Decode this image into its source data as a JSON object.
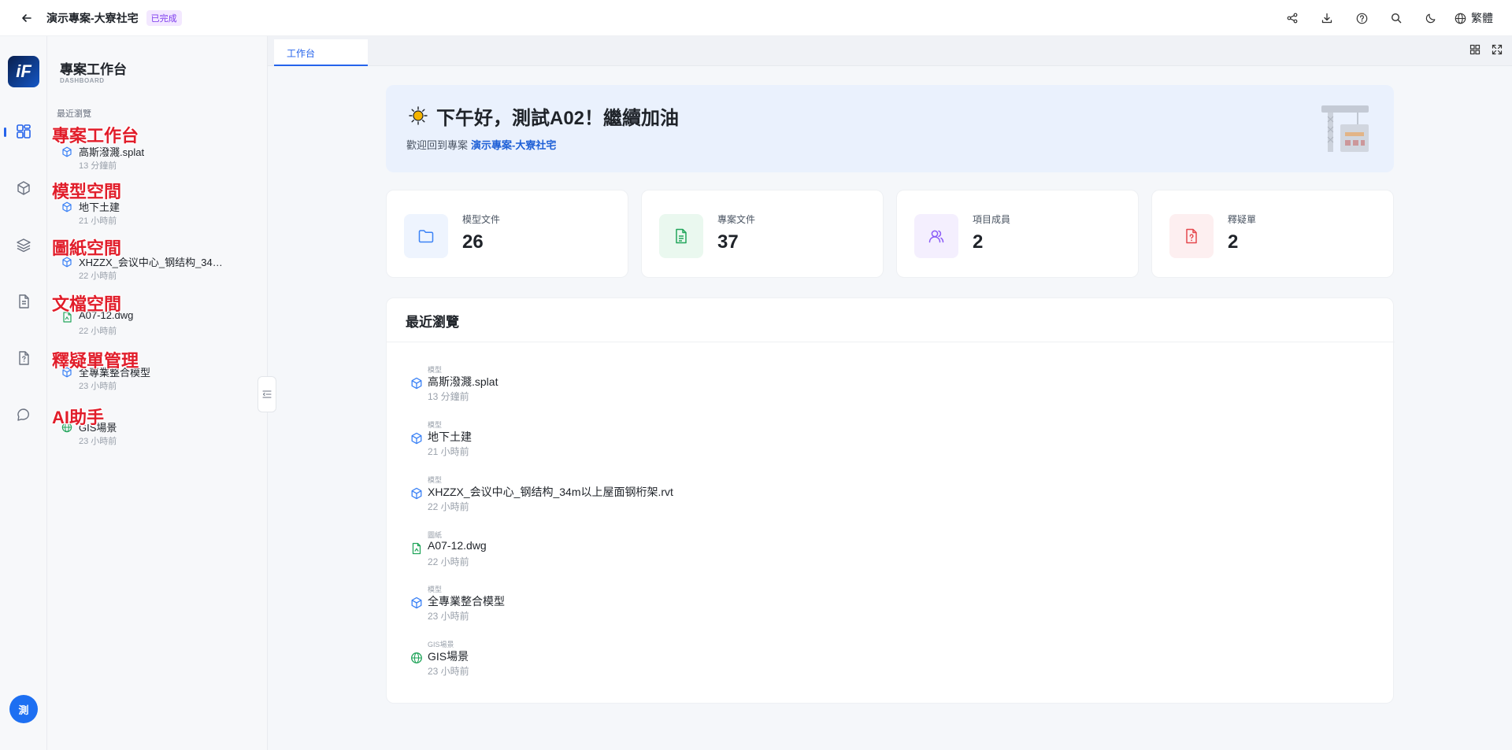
{
  "topbar": {
    "project_title": "演示專案-大寮社宅",
    "status_badge": "已完成",
    "language": "繁體"
  },
  "rail": {
    "avatar_text": "測"
  },
  "sidebar": {
    "title": "專案工作台",
    "subtitle": "DASHBOARD",
    "section_label": "最近瀏覽",
    "nav_labels": [
      "專案工作台",
      "模型空間",
      "圖紙空間",
      "文檔空間",
      "釋疑單管理",
      "AI助手"
    ],
    "recent": [
      {
        "name": "高斯潑濺.splat",
        "time": "13 分鐘前",
        "icon": "cube-icon"
      },
      {
        "name": "地下土建",
        "time": "21 小時前",
        "icon": "cube-icon"
      },
      {
        "name": "XHZZX_会议中心_钢结构_34m以上屋面钢桁架.rvt",
        "time": "22 小時前",
        "icon": "cube-icon"
      },
      {
        "name": "A07-12.dwg",
        "time": "22 小時前",
        "icon": "drawing-file-icon"
      },
      {
        "name": "全專業整合模型",
        "time": "23 小時前",
        "icon": "cube-icon"
      },
      {
        "name": "GIS場景",
        "time": "23 小時前",
        "icon": "globe-icon"
      }
    ]
  },
  "tabs": [
    {
      "label": "工作台"
    }
  ],
  "welcome": {
    "greeting": "下午好，測試A02！繼續加油",
    "sub_prefix": "歡迎回到專案",
    "project_link": "演示專案-大寮社宅"
  },
  "stats": [
    {
      "label": "模型文件",
      "value": "26",
      "color": "#3b82f6",
      "bg": "#eef4fe",
      "icon": "folder-icon"
    },
    {
      "label": "專案文件",
      "value": "37",
      "color": "#22a55b",
      "bg": "#eaf8ef",
      "icon": "document-icon"
    },
    {
      "label": "項目成員",
      "value": "2",
      "color": "#8b5cf6",
      "bg": "#f4effe",
      "icon": "users-icon"
    },
    {
      "label": "釋疑單",
      "value": "2",
      "color": "#e5484d",
      "bg": "#fdeff0",
      "icon": "question-doc-icon"
    }
  ],
  "recent_panel": {
    "title": "最近瀏覽",
    "items": [
      {
        "category": "模型",
        "name": "高斯潑濺.splat",
        "time": "13 分鐘前",
        "icon": "cube-icon"
      },
      {
        "category": "模型",
        "name": "地下土建",
        "time": "21 小時前",
        "icon": "cube-icon"
      },
      {
        "category": "模型",
        "name": "XHZZX_会议中心_钢结构_34m以上屋面钢桁架.rvt",
        "time": "22 小時前",
        "icon": "cube-icon"
      },
      {
        "category": "圖紙",
        "name": "A07-12.dwg",
        "time": "22 小時前",
        "icon": "drawing-file-icon"
      },
      {
        "category": "模型",
        "name": "全專業整合模型",
        "time": "23 小時前",
        "icon": "cube-icon"
      },
      {
        "category": "GIS場景",
        "name": "GIS場景",
        "time": "23 小時前",
        "icon": "globe-icon"
      }
    ]
  }
}
